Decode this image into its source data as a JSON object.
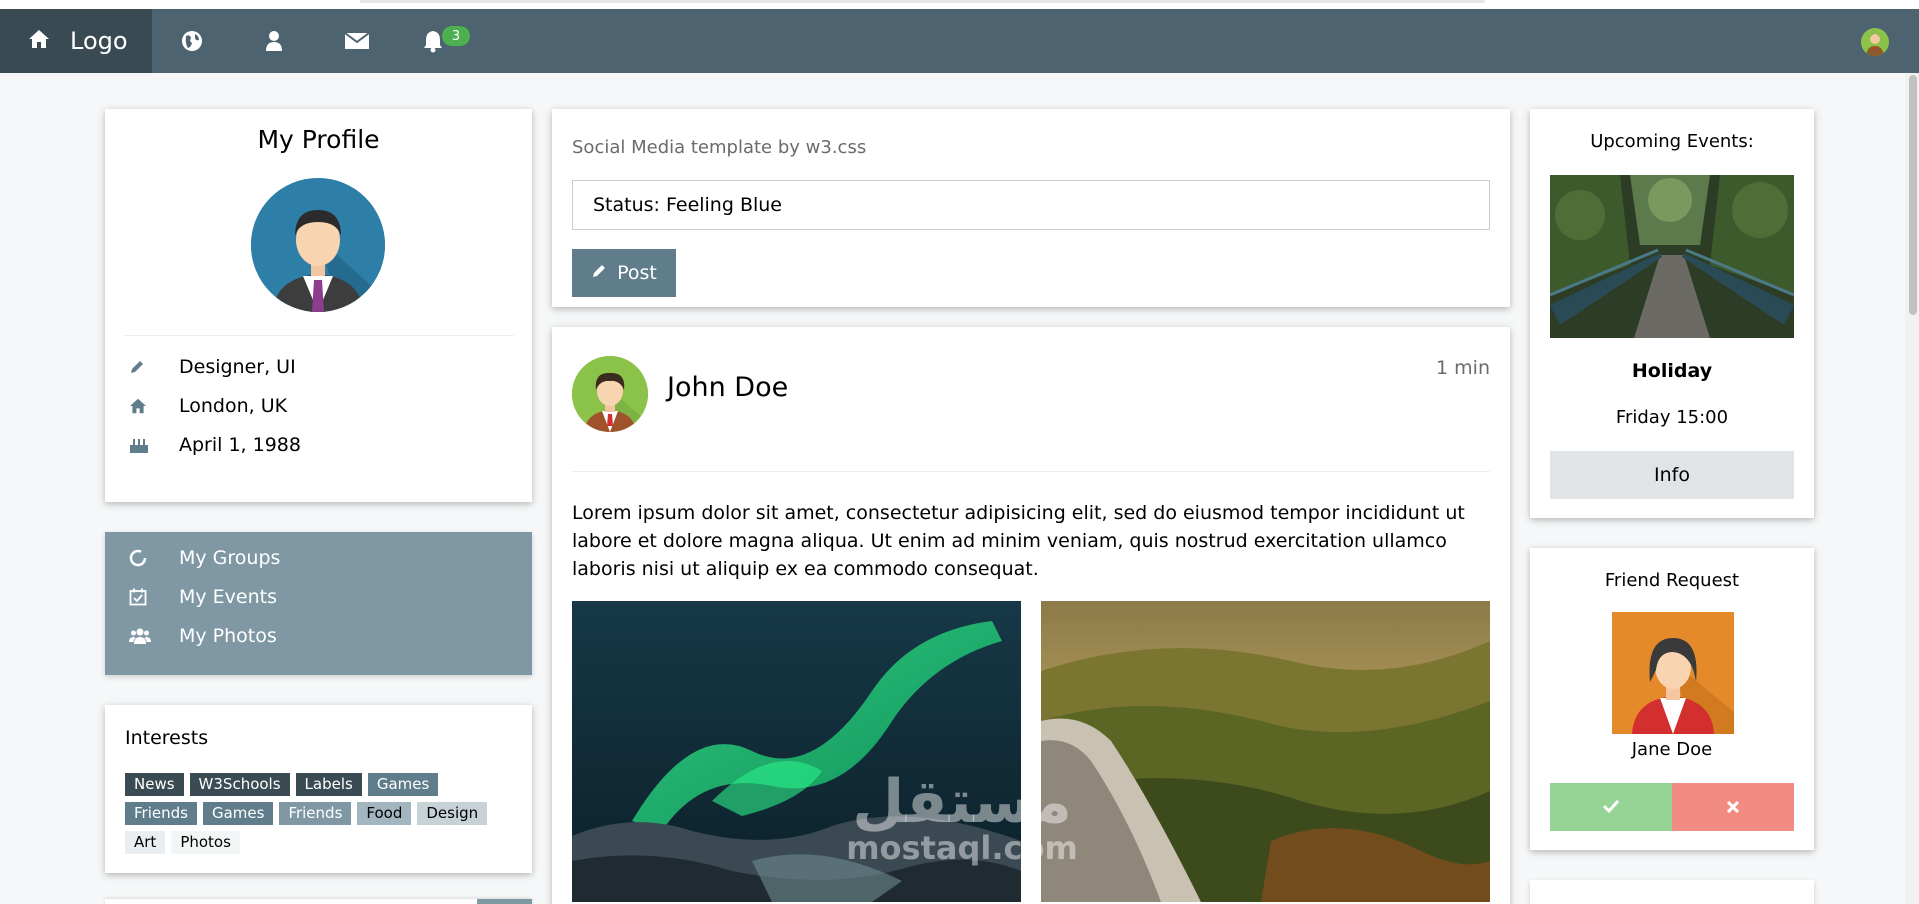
{
  "navbar": {
    "logo_label": "Logo",
    "icons": [
      "home-icon",
      "globe-icon",
      "user-icon",
      "envelope-icon",
      "bell-icon"
    ],
    "notification_count": "3"
  },
  "profile": {
    "title": "My Profile",
    "job": "Designer, UI",
    "location": "London, UK",
    "birthday": "April 1, 1988"
  },
  "menu": {
    "groups": "My Groups",
    "events": "My Events",
    "photos": "My Photos"
  },
  "interests": {
    "title": "Interests",
    "tags": [
      "News",
      "W3Schools",
      "Labels",
      "Games",
      "Friends",
      "Games",
      "Friends",
      "Food",
      "Design",
      "Art",
      "Photos"
    ]
  },
  "composer": {
    "caption": "Social Media template by w3.css",
    "status_value": "Status: Feeling Blue",
    "post_label": "Post"
  },
  "post": {
    "author": "John Doe",
    "time": "1 min",
    "text": "Lorem ipsum dolor sit amet, consectetur adipisicing elit, sed do eiusmod tempor incididunt ut labore et dolore magna aliqua. Ut enim ad minim veniam, quis nostrud exercitation ullamco laboris nisi ut aliquip ex ea commodo consequat."
  },
  "events": {
    "title": "Upcoming Events:",
    "event_name": "Holiday",
    "event_time": "Friday 15:00",
    "info_label": "Info"
  },
  "friend_request": {
    "title": "Friend Request",
    "name": "Jane Doe"
  },
  "watermark": {
    "arabic": "مستقل",
    "latin": "mostaql.com"
  },
  "colors": {
    "navbar": "#4d636f",
    "navbar_logo": "#394a52",
    "accent": "#607d8b",
    "accordion": "#7f98a3",
    "accept": "#95d495",
    "decline": "#f28b82",
    "badge": "#4caf50"
  }
}
